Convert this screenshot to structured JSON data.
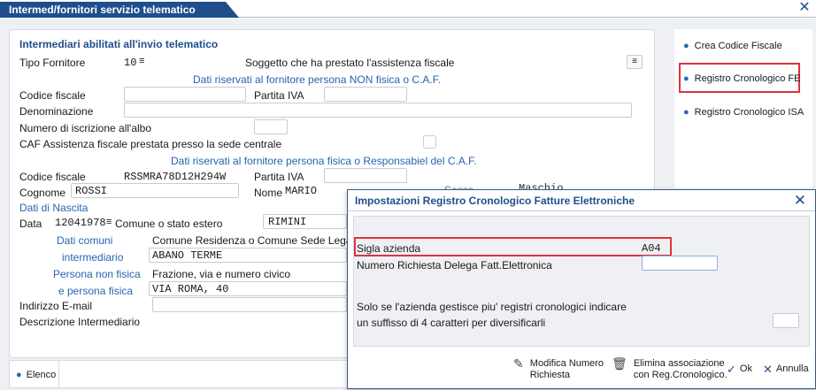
{
  "window": {
    "title": "Intermed/fornitori servizio telematico",
    "close_glyph": "✕"
  },
  "main": {
    "section_title": "Intermediari abilitati all'invio telematico",
    "tipo_fornitore_label": "Tipo Fornitore",
    "tipo_fornitore_value": "10",
    "soggetto_label": "Soggetto che ha prestato l'assistenza fiscale",
    "riservati_nonfisica": "Dati riservati al fornitore persona NON fisica o C.A.F.",
    "codice_fiscale_label": "Codice fiscale",
    "partita_iva_label": "Partita IVA",
    "denominazione_label": "Denominazione",
    "numero_iscrizione_label": "Numero di iscrizione all'albo",
    "caf_label": "CAF Assistenza fiscale prestata presso la sede centrale",
    "riservati_fisica": "Dati riservati al fornitore persona fisica o Responsabiel del C.A.F.",
    "codice_fiscale2_label": "Codice fiscale",
    "codice_fiscale2_value": "RSSMRA78D12H294W",
    "partita_iva2_label": "Partita IVA",
    "cognome_label": "Cognome",
    "cognome_value": "ROSSI",
    "nome_label": "Nome",
    "nome_value": "MARIO",
    "sesso_label": "Sesso",
    "sesso_value": "Maschio",
    "dati_nascita_label": "Dati di Nascita",
    "data_label": "Data",
    "data_value": "12041978",
    "comune_estero_label": "Comune o stato estero",
    "comune_estero_value": "RIMINI",
    "dati_comuni_label": "Dati comuni",
    "comune_residenza_label": "Comune Residenza o Comune Sede Legale",
    "intermediario_label": "intermediario",
    "comune_residenza_value": "ABANO TERME",
    "persona_non_fisica_label": "Persona non fisica",
    "frazione_label": "Frazione, via e numero civico",
    "persona_fisica_label": "e persona fisica",
    "via_value": "VIA ROMA, 40",
    "email_label": "Indirizzo E-mail",
    "descrizione_label": "Descrizione Intermediario"
  },
  "side": {
    "items": [
      {
        "label": "Crea Codice Fiscale"
      },
      {
        "label": "Registro Cronologico FE"
      },
      {
        "label": "Registro Cronologico ISA"
      }
    ]
  },
  "bottom": {
    "elenco_label": "Elenco"
  },
  "dialog": {
    "title": "Impostazioni Registro Cronologico Fatture Elettroniche",
    "sigla_label": "Sigla azienda",
    "sigla_value": "A04",
    "numero_richiesta_label": "Numero Richiesta Delega Fatt.Elettronica",
    "note_line1": "Solo se l'azienda gestisce piu' registri cronologici indicare",
    "note_line2": "un suffisso di 4 caratteri per diversificarli",
    "buttons": {
      "modifica_line1": "Modifica Numero",
      "modifica_line2": "Richiesta",
      "elimina_line1": "Elimina associazione",
      "elimina_line2": "con Reg.Cronologico.",
      "ok": "Ok",
      "annulla": "Annulla"
    }
  },
  "colors": {
    "accent": "#1f4e8c",
    "highlight": "#e0323a"
  }
}
